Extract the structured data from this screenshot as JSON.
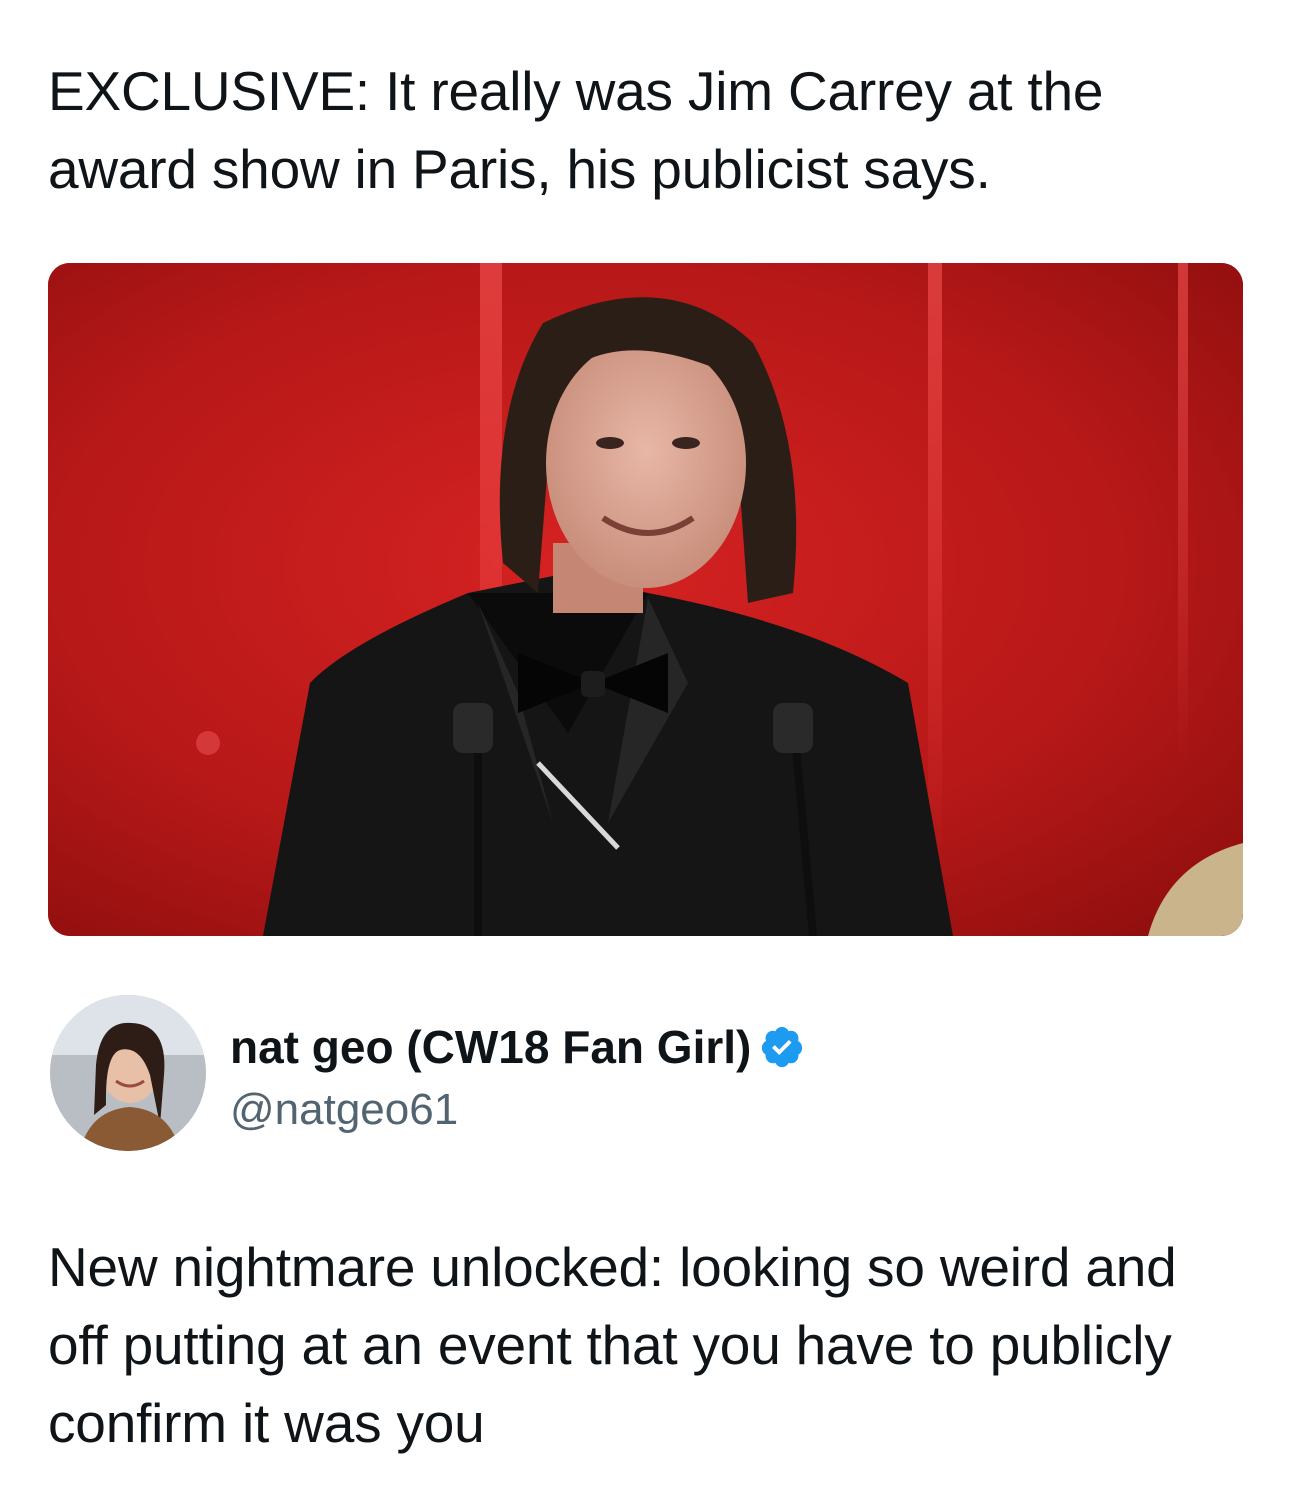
{
  "quoted_post": {
    "headline": "EXCLUSIVE: It really was Jim Carrey at the award show in Paris, his publicist says."
  },
  "author": {
    "display_name": "nat geo (CW18 Fan Girl)",
    "handle": "@natgeo61",
    "verified": true
  },
  "post": {
    "text": "New nightmare unlocked: looking so weird and off putting at an event that you have to publicly confirm it was you"
  },
  "colors": {
    "verified_badge": "#1d9bf0",
    "handle": "#536471",
    "text": "#0f1419",
    "photo_background": "#b51616"
  }
}
